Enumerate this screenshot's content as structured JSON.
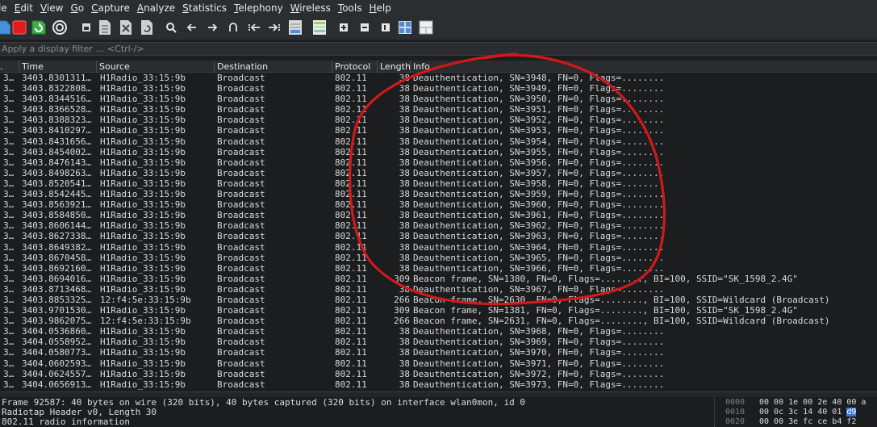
{
  "menu": [
    {
      "label": "le",
      "mnemonic": ""
    },
    {
      "label": "dit",
      "mnemonic": "E"
    },
    {
      "label": "iew",
      "mnemonic": "V"
    },
    {
      "label": "o",
      "mnemonic": "G"
    },
    {
      "label": "apture",
      "mnemonic": "C"
    },
    {
      "label": "nalyze",
      "mnemonic": "A"
    },
    {
      "label": "tatistics",
      "mnemonic": "S"
    },
    {
      "label": "elephony",
      "mnemonic": "T"
    },
    {
      "label": "ireless",
      "mnemonic": "W"
    },
    {
      "label": "ools",
      "mnemonic": "T"
    },
    {
      "label": "elp",
      "mnemonic": "H"
    }
  ],
  "toolbar": {
    "icons": [
      "start-capture-icon",
      "stop-capture-icon",
      "restart-capture-icon",
      "capture-options-icon",
      "open-file-icon",
      "save-file-icon",
      "close-file-icon",
      "reload-file-icon",
      "find-packet-icon",
      "go-back-icon",
      "go-forward-icon",
      "go-to-packet-icon",
      "go-first-icon",
      "go-last-icon",
      "autoscroll-icon",
      "colorize-icon",
      "zoom-in-icon",
      "zoom-out-icon",
      "normal-size-icon",
      "resize-columns-icon",
      "split-view-icon"
    ],
    "colors": {
      "stop": "#e01b1b",
      "restart": "#3fae49",
      "accent": "#4a90d9"
    }
  },
  "filter": {
    "placeholder": "Apply a display filter … <Ctrl-/>",
    "value": ""
  },
  "columns": {
    "no": ".",
    "time": "Time",
    "source": "Source",
    "destination": "Destination",
    "protocol": "Protocol",
    "length": "Length",
    "info": "Info"
  },
  "packets": [
    {
      "no": "3…",
      "time": "3403.8301311…",
      "source": "H1Radio_33:15:9b",
      "destination": "Broadcast",
      "protocol": "802.11",
      "length": "38",
      "info": "Deauthentication, SN=3948, FN=0, Flags=........"
    },
    {
      "no": "3…",
      "time": "3403.8322808…",
      "source": "H1Radio_33:15:9b",
      "destination": "Broadcast",
      "protocol": "802.11",
      "length": "38",
      "info": "Deauthentication, SN=3949, FN=0, Flags=........"
    },
    {
      "no": "3…",
      "time": "3403.8344516…",
      "source": "H1Radio_33:15:9b",
      "destination": "Broadcast",
      "protocol": "802.11",
      "length": "38",
      "info": "Deauthentication, SN=3950, FN=0, Flags=........"
    },
    {
      "no": "3…",
      "time": "3403.8366528…",
      "source": "H1Radio_33:15:9b",
      "destination": "Broadcast",
      "protocol": "802.11",
      "length": "38",
      "info": "Deauthentication, SN=3951, FN=0, Flags=........"
    },
    {
      "no": "3…",
      "time": "3403.8388323…",
      "source": "H1Radio_33:15:9b",
      "destination": "Broadcast",
      "protocol": "802.11",
      "length": "38",
      "info": "Deauthentication, SN=3952, FN=0, Flags=........"
    },
    {
      "no": "3…",
      "time": "3403.8410297…",
      "source": "H1Radio_33:15:9b",
      "destination": "Broadcast",
      "protocol": "802.11",
      "length": "38",
      "info": "Deauthentication, SN=3953, FN=0, Flags=........"
    },
    {
      "no": "3…",
      "time": "3403.8431656…",
      "source": "H1Radio_33:15:9b",
      "destination": "Broadcast",
      "protocol": "802.11",
      "length": "38",
      "info": "Deauthentication, SN=3954, FN=0, Flags=........"
    },
    {
      "no": "3…",
      "time": "3403.8454002…",
      "source": "H1Radio_33:15:9b",
      "destination": "Broadcast",
      "protocol": "802.11",
      "length": "38",
      "info": "Deauthentication, SN=3955, FN=0, Flags=........"
    },
    {
      "no": "3…",
      "time": "3403.8476143…",
      "source": "H1Radio_33:15:9b",
      "destination": "Broadcast",
      "protocol": "802.11",
      "length": "38",
      "info": "Deauthentication, SN=3956, FN=0, Flags=........"
    },
    {
      "no": "3…",
      "time": "3403.8498263…",
      "source": "H1Radio_33:15:9b",
      "destination": "Broadcast",
      "protocol": "802.11",
      "length": "38",
      "info": "Deauthentication, SN=3957, FN=0, Flags=........"
    },
    {
      "no": "3…",
      "time": "3403.8520541…",
      "source": "H1Radio_33:15:9b",
      "destination": "Broadcast",
      "protocol": "802.11",
      "length": "38",
      "info": "Deauthentication, SN=3958, FN=0, Flags=........"
    },
    {
      "no": "3…",
      "time": "3403.8542445…",
      "source": "H1Radio_33:15:9b",
      "destination": "Broadcast",
      "protocol": "802.11",
      "length": "38",
      "info": "Deauthentication, SN=3959, FN=0, Flags=........"
    },
    {
      "no": "3…",
      "time": "3403.8563921…",
      "source": "H1Radio_33:15:9b",
      "destination": "Broadcast",
      "protocol": "802.11",
      "length": "38",
      "info": "Deauthentication, SN=3960, FN=0, Flags=........"
    },
    {
      "no": "3…",
      "time": "3403.8584850…",
      "source": "H1Radio_33:15:9b",
      "destination": "Broadcast",
      "protocol": "802.11",
      "length": "38",
      "info": "Deauthentication, SN=3961, FN=0, Flags=........"
    },
    {
      "no": "3…",
      "time": "3403.8606144…",
      "source": "H1Radio_33:15:9b",
      "destination": "Broadcast",
      "protocol": "802.11",
      "length": "38",
      "info": "Deauthentication, SN=3962, FN=0, Flags=........"
    },
    {
      "no": "3…",
      "time": "3403.8627338…",
      "source": "H1Radio_33:15:9b",
      "destination": "Broadcast",
      "protocol": "802.11",
      "length": "38",
      "info": "Deauthentication, SN=3963, FN=0, Flags=........"
    },
    {
      "no": "3…",
      "time": "3403.8649382…",
      "source": "H1Radio_33:15:9b",
      "destination": "Broadcast",
      "protocol": "802.11",
      "length": "38",
      "info": "Deauthentication, SN=3964, FN=0, Flags=........"
    },
    {
      "no": "3…",
      "time": "3403.8670458…",
      "source": "H1Radio_33:15:9b",
      "destination": "Broadcast",
      "protocol": "802.11",
      "length": "38",
      "info": "Deauthentication, SN=3965, FN=0, Flags=........"
    },
    {
      "no": "3…",
      "time": "3403.8692160…",
      "source": "H1Radio_33:15:9b",
      "destination": "Broadcast",
      "protocol": "802.11",
      "length": "38",
      "info": "Deauthentication, SN=3966, FN=0, Flags=........"
    },
    {
      "no": "3…",
      "time": "3403.8694016…",
      "source": "H1Radio_33:15:9b",
      "destination": "Broadcast",
      "protocol": "802.11",
      "length": "309",
      "info": "Beacon frame, SN=1380, FN=0, Flags=........, BI=100, SSID=\"SK_1598_2.4G\""
    },
    {
      "no": "3…",
      "time": "3403.8713468…",
      "source": "H1Radio_33:15:9b",
      "destination": "Broadcast",
      "protocol": "802.11",
      "length": "38",
      "info": "Deauthentication, SN=3967, FN=0, Flags=........"
    },
    {
      "no": "3…",
      "time": "3403.8853325…",
      "source": "12:f4:5e:33:15:9b",
      "destination": "Broadcast",
      "protocol": "802.11",
      "length": "266",
      "info": "Beacon frame, SN=2630, FN=0, Flags=........, BI=100, SSID=Wildcard (Broadcast)"
    },
    {
      "no": "3…",
      "time": "3403.9701530…",
      "source": "H1Radio_33:15:9b",
      "destination": "Broadcast",
      "protocol": "802.11",
      "length": "309",
      "info": "Beacon frame, SN=1381, FN=0, Flags=........, BI=100, SSID=\"SK_1598_2.4G\""
    },
    {
      "no": "3…",
      "time": "3403.9862075…",
      "source": "12:f4:5e:33:15:9b",
      "destination": "Broadcast",
      "protocol": "802.11",
      "length": "266",
      "info": "Beacon frame, SN=2631, FN=0, Flags=........, BI=100, SSID=Wildcard (Broadcast)"
    },
    {
      "no": "3…",
      "time": "3404.0536860…",
      "source": "H1Radio_33:15:9b",
      "destination": "Broadcast",
      "protocol": "802.11",
      "length": "38",
      "info": "Deauthentication, SN=3968, FN=0, Flags=........"
    },
    {
      "no": "3…",
      "time": "3404.0558952…",
      "source": "H1Radio_33:15:9b",
      "destination": "Broadcast",
      "protocol": "802.11",
      "length": "38",
      "info": "Deauthentication, SN=3969, FN=0, Flags=........"
    },
    {
      "no": "3…",
      "time": "3404.0580773…",
      "source": "H1Radio_33:15:9b",
      "destination": "Broadcast",
      "protocol": "802.11",
      "length": "38",
      "info": "Deauthentication, SN=3970, FN=0, Flags=........"
    },
    {
      "no": "3…",
      "time": "3404.0602593…",
      "source": "H1Radio_33:15:9b",
      "destination": "Broadcast",
      "protocol": "802.11",
      "length": "38",
      "info": "Deauthentication, SN=3971, FN=0, Flags=........"
    },
    {
      "no": "3…",
      "time": "3404.0624557…",
      "source": "H1Radio_33:15:9b",
      "destination": "Broadcast",
      "protocol": "802.11",
      "length": "38",
      "info": "Deauthentication, SN=3972, FN=0, Flags=........"
    },
    {
      "no": "3…",
      "time": "3404.0656913…",
      "source": "H1Radio_33:15:9b",
      "destination": "Broadcast",
      "protocol": "802.11",
      "length": "38",
      "info": "Deauthentication, SN=3973, FN=0, Flags=........"
    }
  ],
  "details": [
    "Frame 92587: 40 bytes on wire (320 bits), 40 bytes captured (320 bits) on interface wlan0mon, id 0",
    "Radiotap Header v0, Length 30",
    "802.11 radio information"
  ],
  "bytes": [
    {
      "offset": "0000",
      "hex": "00 00 1e 00 2e 40 00 a",
      "selected": ""
    },
    {
      "offset": "0010",
      "hex": "00 0c 3c 14 40 01 ",
      "selected": "d9"
    },
    {
      "offset": "0020",
      "hex": "00 00 3e fc ce b4 f2",
      "selected": ""
    }
  ],
  "annotation": {
    "color": "#d01919"
  }
}
